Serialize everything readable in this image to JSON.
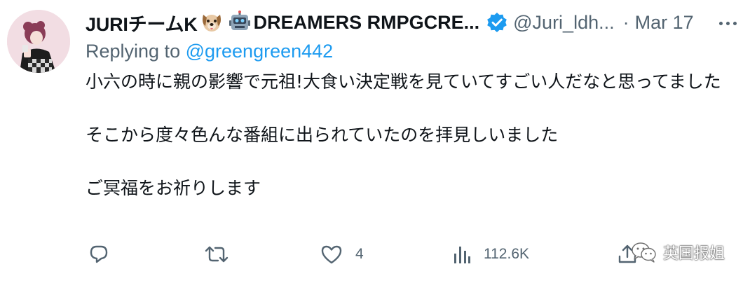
{
  "tweet": {
    "display_name": "JURIチームK",
    "display_name_suffix": "DREAMERS RMPGCRE...",
    "handle": "@Juri_ldh...",
    "date": "Mar 17",
    "reply_prefix": "Replying to",
    "reply_handle": "@greengreen442",
    "body": [
      "小六の時に親の影響で元祖!大食い決定戦を見ていてすごい人だなと思ってました",
      "そこから度々色んな番組に出られていたのを拝見しいました",
      "ご冥福をお祈りします"
    ],
    "icons": [
      "dog-emoji-icon",
      "robot-emoji-icon",
      "verified-badge-icon",
      "more-icon"
    ],
    "accent_color": "#1d9bf0"
  },
  "actions": {
    "reply": {
      "icon": "reply-icon",
      "count": ""
    },
    "retweet": {
      "icon": "retweet-icon",
      "count": ""
    },
    "like": {
      "icon": "like-icon",
      "count": "4"
    },
    "views": {
      "icon": "views-icon",
      "count": "112.6K"
    },
    "share": {
      "icon": "share-icon"
    }
  },
  "watermark": {
    "text": "英国报姐",
    "icon": "wechat-icon"
  }
}
